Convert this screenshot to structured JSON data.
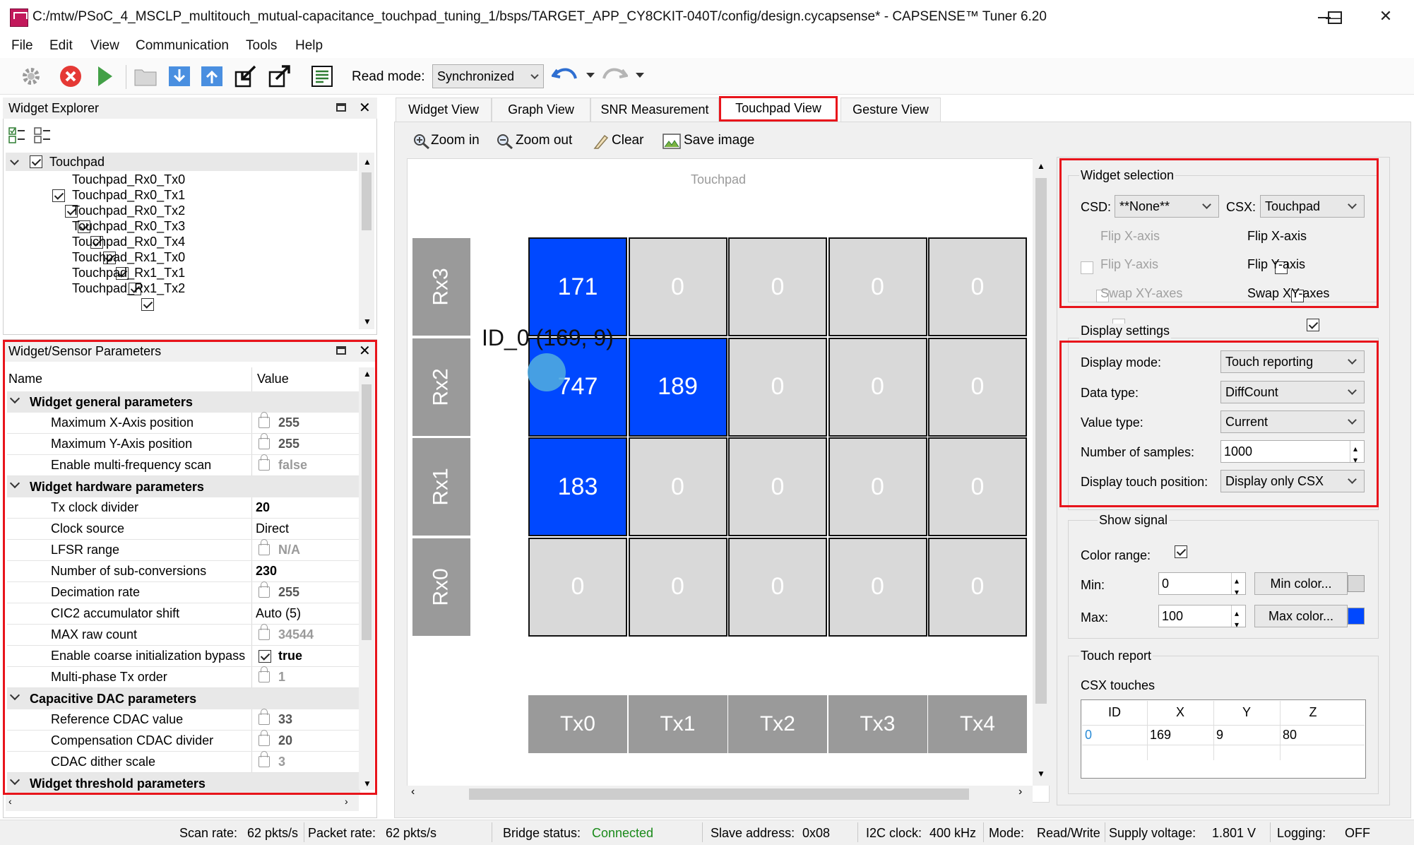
{
  "window": {
    "title": "C:/mtw/PSoC_4_MSCLP_multitouch_mutual-capacitance_touchpad_tuning_1/bsps/TARGET_APP_CY8CKIT-040T/config/design.cycapsense* - CAPSENSE™ Tuner 6.20",
    "app_icon_text": "TUNE",
    "minimize": "—",
    "maximize": "☐",
    "close": "✕"
  },
  "menu": [
    "File",
    "Edit",
    "View",
    "Communication",
    "Tools",
    "Help"
  ],
  "toolbar": {
    "read_mode_label": "Read mode:",
    "read_mode_value": "Synchronized"
  },
  "widget_explorer": {
    "title": "Widget Explorer",
    "root": "Touchpad",
    "items": [
      "Touchpad_Rx0_Tx0",
      "Touchpad_Rx0_Tx1",
      "Touchpad_Rx0_Tx2",
      "Touchpad_Rx0_Tx3",
      "Touchpad_Rx0_Tx4",
      "Touchpad_Rx1_Tx0",
      "Touchpad_Rx1_Tx1",
      "Touchpad_Rx1_Tx2"
    ]
  },
  "params": {
    "title": "Widget/Sensor Parameters",
    "col_name": "Name",
    "col_value": "Value",
    "groups": [
      {
        "name": "Widget general parameters",
        "rows": [
          {
            "name": "Maximum X-Axis position",
            "value": "255",
            "locked": true
          },
          {
            "name": "Maximum Y-Axis position",
            "value": "255",
            "locked": true
          },
          {
            "name": "Enable multi-frequency scan",
            "value": "false",
            "locked": true
          }
        ]
      },
      {
        "name": "Widget hardware parameters",
        "rows": [
          {
            "name": "Tx clock divider",
            "value": "20",
            "locked": false,
            "bold": true
          },
          {
            "name": "Clock source",
            "value": "Direct",
            "locked": false
          },
          {
            "name": "LFSR range",
            "value": "N/A",
            "locked": true
          },
          {
            "name": "Number of sub-conversions",
            "value": "230",
            "locked": false,
            "bold": true
          },
          {
            "name": "Decimation rate",
            "value": "255",
            "locked": true
          },
          {
            "name": "CIC2 accumulator shift",
            "value": "Auto (5)",
            "locked": false
          },
          {
            "name": "MAX raw count",
            "value": "34544",
            "locked": true
          },
          {
            "name": "Enable coarse initialization bypass",
            "value": "true",
            "locked": false,
            "checkbox": true,
            "bold": true
          },
          {
            "name": "Multi-phase Tx order",
            "value": "1",
            "locked": true
          }
        ]
      },
      {
        "name": "Capacitive DAC parameters",
        "rows": [
          {
            "name": "Reference CDAC value",
            "value": "33",
            "locked": true
          },
          {
            "name": "Compensation CDAC divider",
            "value": "20",
            "locked": true
          },
          {
            "name": "CDAC dither scale",
            "value": "3",
            "locked": true
          }
        ]
      },
      {
        "name": "Widget threshold parameters",
        "rows": []
      }
    ]
  },
  "tabs": [
    "Widget View",
    "Graph View",
    "SNR Measurement",
    "Touchpad View",
    "Gesture View"
  ],
  "view_toolbar": {
    "zoom_in": "Zoom in",
    "zoom_out": "Zoom out",
    "clear": "Clear",
    "save_image": "Save image"
  },
  "touchpad": {
    "title": "Touchpad",
    "rows": [
      "Rx3",
      "Rx2",
      "Rx1",
      "Rx0"
    ],
    "cols": [
      "Tx0",
      "Tx1",
      "Tx2",
      "Tx3",
      "Tx4"
    ],
    "values": [
      [
        "171",
        "0",
        "0",
        "0",
        "0"
      ],
      [
        "747",
        "189",
        "0",
        "0",
        "0"
      ],
      [
        "183",
        "0",
        "0",
        "0",
        "0"
      ],
      [
        "0",
        "0",
        "0",
        "0",
        "0"
      ]
    ],
    "touch_label": "ID_0 (169, 9)"
  },
  "widget_selection": {
    "title": "Widget selection",
    "csd_label": "CSD:",
    "csd_value": "**None**",
    "csx_label": "CSX:",
    "csx_value": "Touchpad",
    "csd_flip_x": "Flip X-axis",
    "csd_flip_y": "Flip Y-axis",
    "csd_swap": "Swap XY-axes",
    "csx_flip_x": "Flip X-axis",
    "csx_flip_y": "Flip Y-axis",
    "csx_swap": "Swap XY-axes"
  },
  "display_settings": {
    "title": "Display settings",
    "display_mode_label": "Display mode:",
    "display_mode": "Touch reporting",
    "data_type_label": "Data type:",
    "data_type": "DiffCount",
    "value_type_label": "Value type:",
    "value_type": "Current",
    "samples_label": "Number of samples:",
    "samples": "1000",
    "touch_pos_label": "Display touch position:",
    "touch_pos": "Display only CSX"
  },
  "signal": {
    "show_signal": "Show signal",
    "color_range": "Color range:",
    "min_label": "Min:",
    "min_value": "0",
    "min_btn": "Min color...",
    "max_label": "Max:",
    "max_value": "100",
    "max_btn": "Max color...",
    "min_color": "#d9d9d9",
    "max_color": "#0048ff"
  },
  "touch_report": {
    "title": "Touch report",
    "subtitle": "CSX touches",
    "headers": [
      "ID",
      "X",
      "Y",
      "Z"
    ],
    "rows": [
      [
        "0",
        "169",
        "9",
        "80"
      ]
    ]
  },
  "status": {
    "scan_rate_label": "Scan rate:",
    "scan_rate": "62 pkts/s",
    "packet_rate_label": "Packet rate:",
    "packet_rate": "62 pkts/s",
    "bridge_label": "Bridge status:",
    "bridge": "Connected",
    "slave_label": "Slave address:",
    "slave": "0x08",
    "i2c_label": "I2C clock:",
    "i2c": "400 kHz",
    "mode_label": "Mode:",
    "mode": "Read/Write",
    "supply_label": "Supply voltage:",
    "supply": "1.801 V",
    "logging_label": "Logging:",
    "logging": "OFF"
  },
  "colors": {
    "accent_red": "#e8141b",
    "touch_blue": "#0048ff",
    "connected_green": "#1a8a1a"
  }
}
